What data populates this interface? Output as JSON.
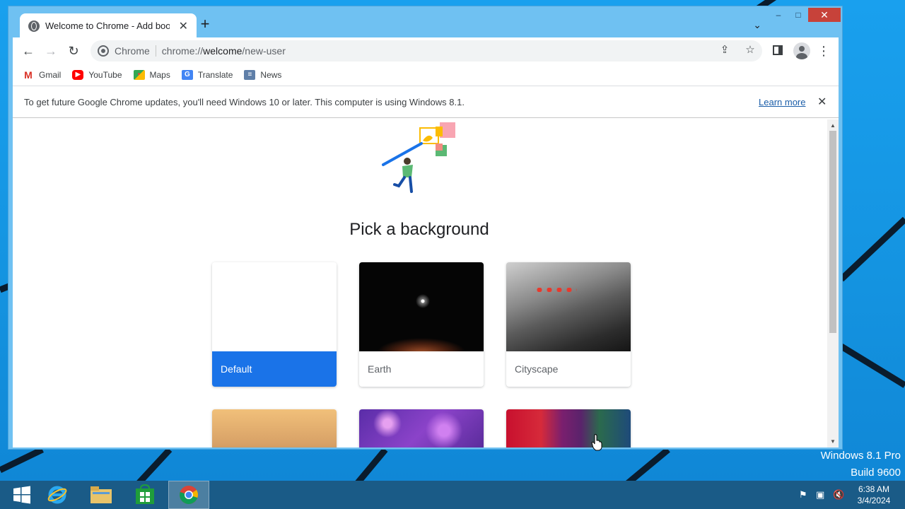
{
  "window": {
    "tab_title": "Welcome to Chrome - Add book",
    "new_tab": "+",
    "minimize": "–",
    "maximize": "□",
    "close": "✕"
  },
  "toolbar": {
    "site_chip": "Chrome",
    "url_prefix": "chrome://",
    "url_host": "welcome",
    "url_path": "/new-user"
  },
  "bookmarks": [
    {
      "label": "Gmail",
      "icon": "gmail-icon",
      "color": "#d93025"
    },
    {
      "label": "YouTube",
      "icon": "youtube-icon",
      "color": "#ff0000"
    },
    {
      "label": "Maps",
      "icon": "maps-icon",
      "color": "#34a853"
    },
    {
      "label": "Translate",
      "icon": "translate-icon",
      "color": "#4285f4"
    },
    {
      "label": "News",
      "icon": "news-icon",
      "color": "#4285f4"
    }
  ],
  "infobar": {
    "message": "To get future Google Chrome updates, you'll need Windows 10 or later. This computer is using Windows 8.1.",
    "link": "Learn more",
    "close": "✕"
  },
  "page": {
    "heading": "Pick a background",
    "cards": [
      {
        "label": "Default",
        "selected": true
      },
      {
        "label": "Earth",
        "selected": false
      },
      {
        "label": "Cityscape",
        "selected": false
      }
    ]
  },
  "desktop": {
    "edition_line1": "Windows 8.1 Pro",
    "edition_line2": "Build 9600"
  },
  "taskbar": {
    "time": "6:38 AM",
    "date": "3/4/2024"
  },
  "colors": {
    "accent": "#1a73e8",
    "desktop": "#1493e0",
    "taskbar": "#1a5b87"
  }
}
